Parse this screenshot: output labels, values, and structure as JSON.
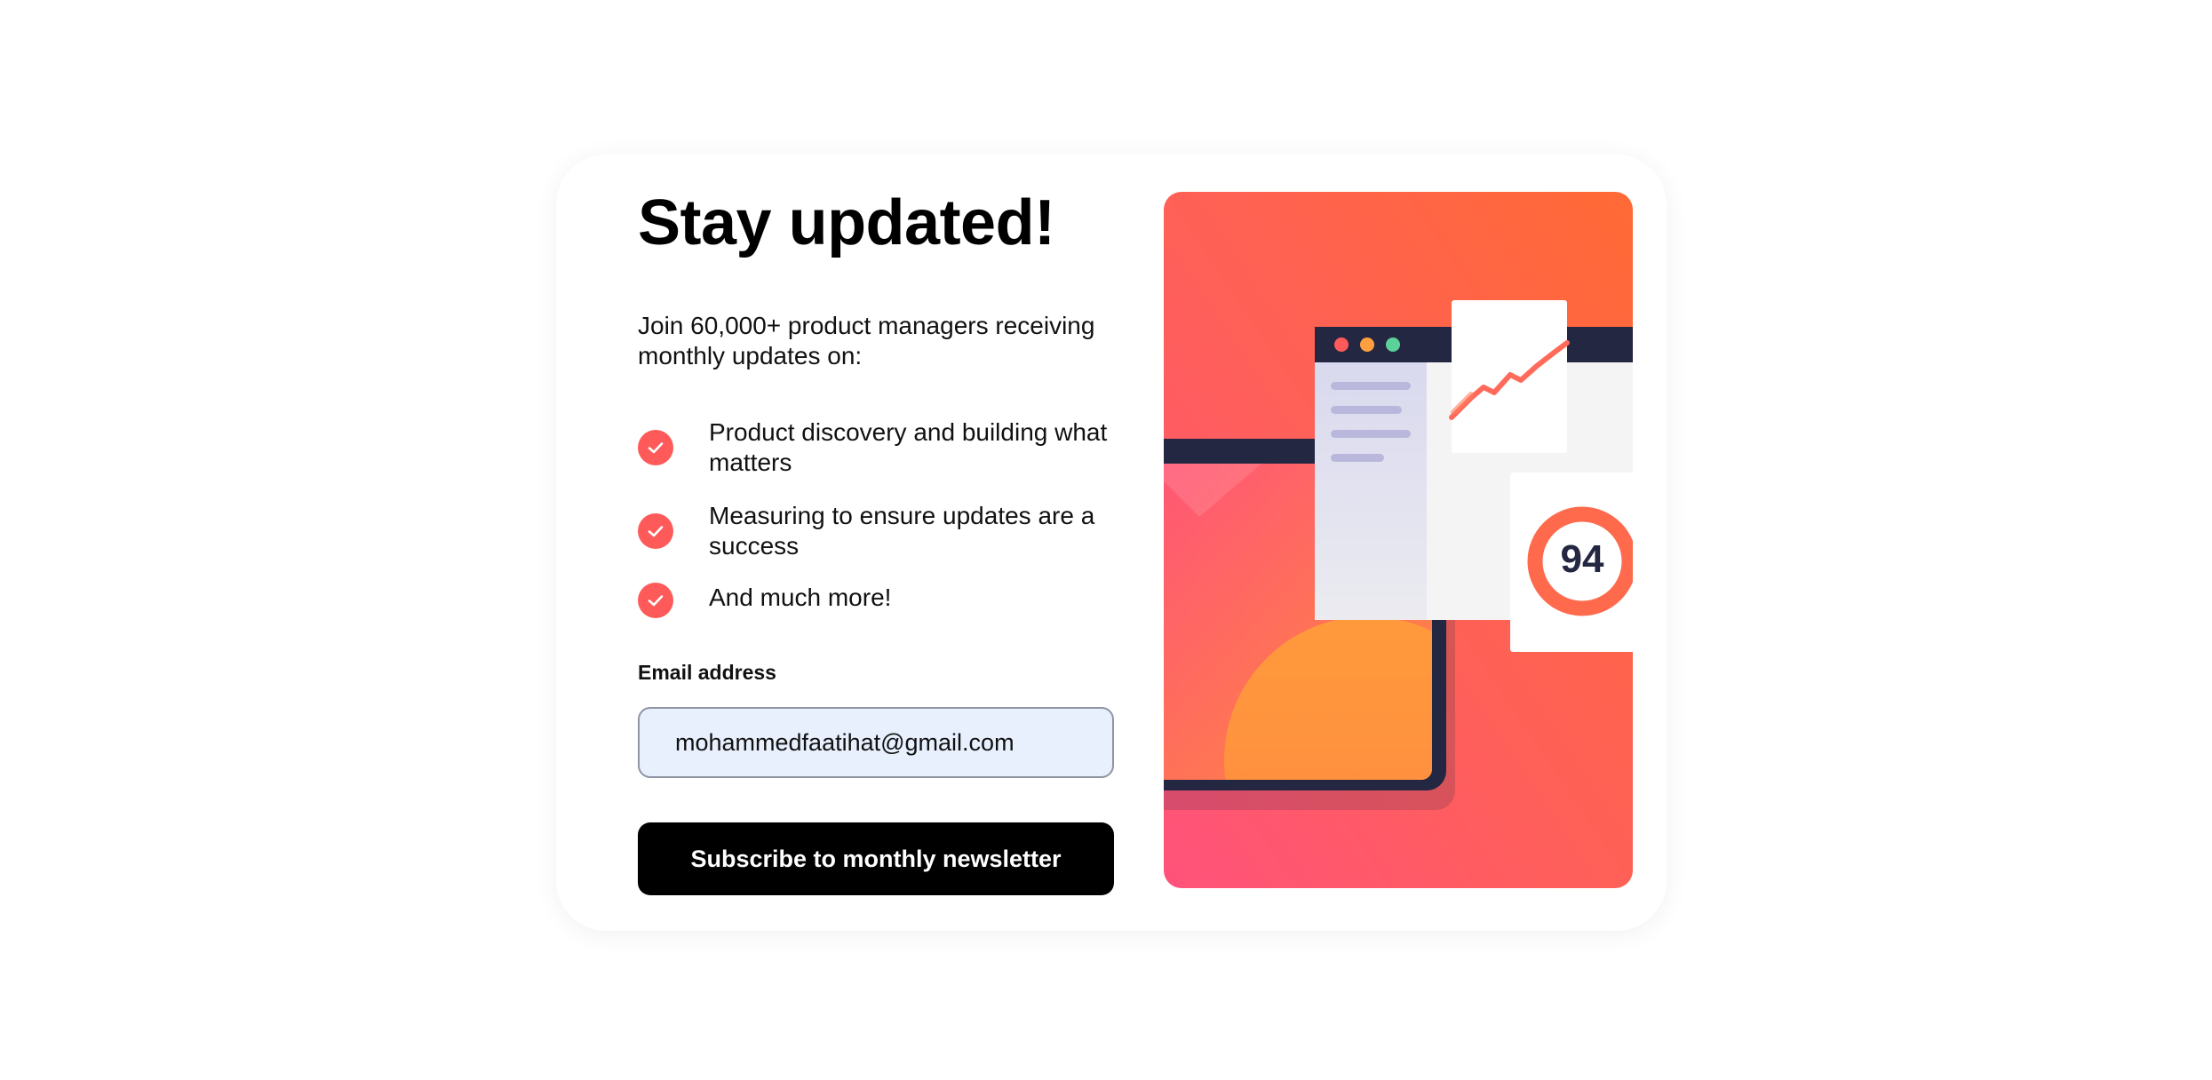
{
  "card": {
    "title": "Stay updated!",
    "intro": "Join 60,000+ product managers receiving monthly updates on:",
    "benefits": [
      {
        "icon": "check-icon",
        "text": "Product discovery and building what matters"
      },
      {
        "icon": "check-icon",
        "text": "Measuring to ensure updates are a success"
      },
      {
        "icon": "check-icon",
        "text": "And much more!"
      }
    ],
    "form": {
      "email_label": "Email address",
      "email_value": "mohammedfaatihat@gmail.com",
      "submit_label": "Subscribe to monthly newsletter"
    }
  },
  "illustration": {
    "score": "94",
    "colors": {
      "gradient_top": "#ff6b3d",
      "gradient_bottom": "#ff527b",
      "navy": "#242742",
      "ring": "#ff6a4d"
    }
  },
  "colors": {
    "accent": "#ff5a5a",
    "button_bg": "#000000",
    "input_bg": "#e8f0fe"
  }
}
